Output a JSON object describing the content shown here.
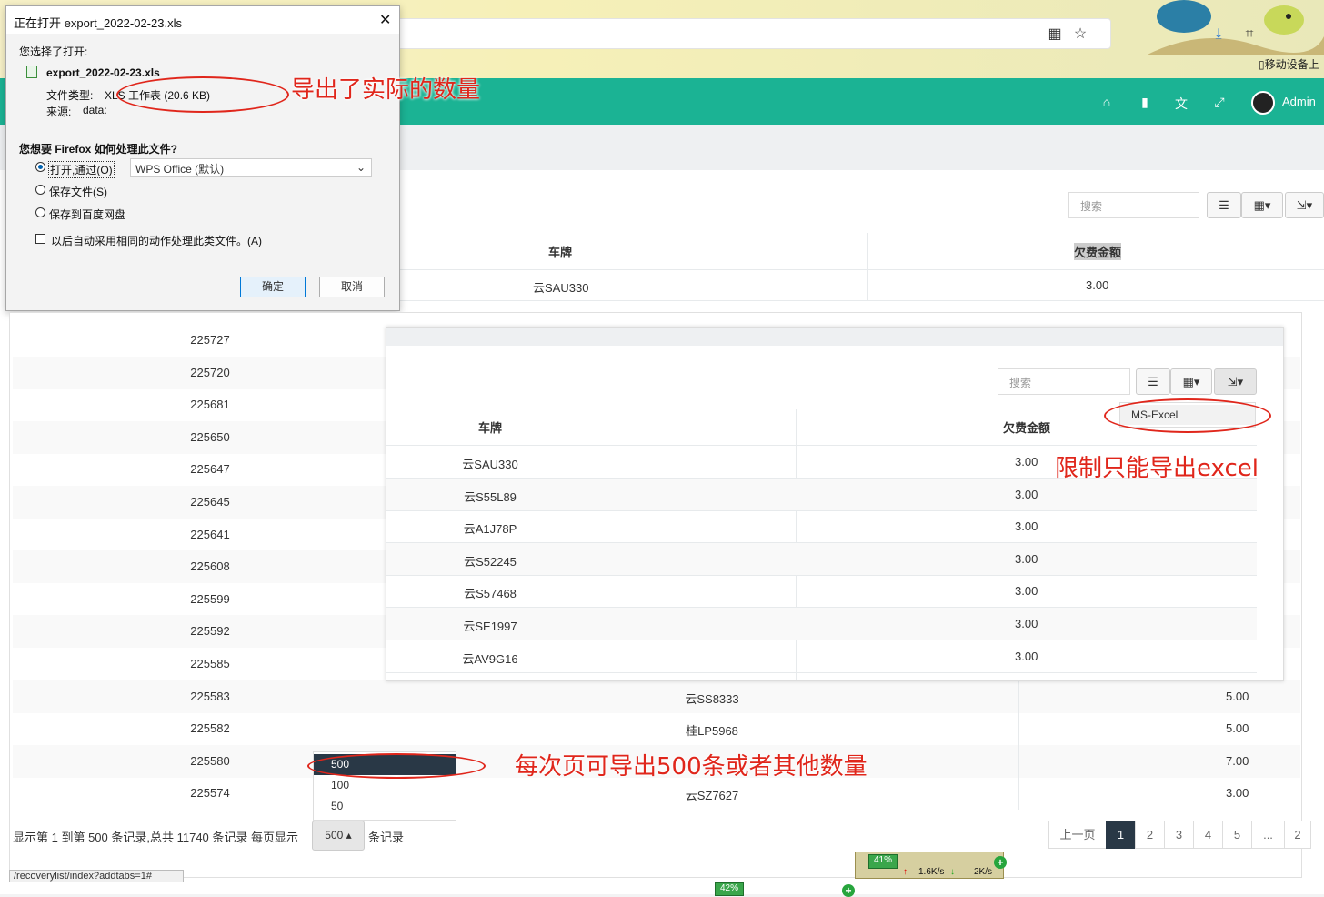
{
  "browser": {
    "mobile_device_label": "移动设备上",
    "qr_icon": "qr-code-icon",
    "bookmark_icon": "star-icon"
  },
  "header": {
    "user_name": "Admin",
    "accent_color": "#1bb394"
  },
  "back_table": {
    "search_placeholder": "搜索",
    "col_plate": "车牌",
    "col_amount": "欠费金额",
    "first_row_plate": "云SAU330",
    "first_row_amount": "3.00"
  },
  "dialog": {
    "title": "正在打开 export_2022-02-23.xls",
    "chosen_label": "您选择了打开:",
    "file_name": "export_2022-02-23.xls",
    "type_label": "文件类型:",
    "type_value": "XLS 工作表 (20.6 KB)",
    "source_label": "来源:",
    "source_value": "data:",
    "question": "您想要 Firefox 如何处理此文件?",
    "option_open": "打开,通过(O)",
    "open_app": "WPS Office (默认)",
    "option_save": "保存文件(S)",
    "option_baidu": "保存到百度网盘",
    "auto_checkbox": "以后自动采用相同的动作处理此类文件。(A)",
    "ok": "确定",
    "cancel": "取消"
  },
  "annotations": {
    "exported_count": "导出了实际的数量",
    "excel_only": "限制只能导出excel",
    "per_page": "每次页可导出500条或者其他数量"
  },
  "list": {
    "rows": [
      {
        "id": "225727"
      },
      {
        "id": "225720"
      },
      {
        "id": "225681"
      },
      {
        "id": "225650"
      },
      {
        "id": "225647"
      },
      {
        "id": "225645"
      },
      {
        "id": "225641"
      },
      {
        "id": "225608"
      },
      {
        "id": "225599"
      },
      {
        "id": "225592"
      },
      {
        "id": "225585"
      },
      {
        "id": "225583",
        "plate": "云SS8333",
        "amount": "5.00"
      },
      {
        "id": "225582",
        "plate": "桂LP5968",
        "amount": "5.00"
      },
      {
        "id": "225580",
        "plate": "",
        "amount": "7.00"
      },
      {
        "id": "225574",
        "plate": "云SZ7627",
        "amount": "3.00"
      }
    ]
  },
  "overlay": {
    "search_placeholder": "搜索",
    "export_option": "MS-Excel",
    "col_plate": "车牌",
    "col_amount": "欠费金额",
    "rows": [
      {
        "plate": "云SAU330",
        "amount": "3.00"
      },
      {
        "plate": "云S55L89",
        "amount": "3.00"
      },
      {
        "plate": "云A1J78P",
        "amount": "3.00"
      },
      {
        "plate": "云S52245",
        "amount": "3.00"
      },
      {
        "plate": "云S57468",
        "amount": "3.00"
      },
      {
        "plate": "云SE1997",
        "amount": "3.00"
      },
      {
        "plate": "云AV9G16",
        "amount": "3.00"
      }
    ]
  },
  "pagination": {
    "summary": "显示第 1 到第 500 条记录,总共 11740 条记录 每页显示",
    "page_size": "500",
    "suffix": "条记录",
    "options": [
      "500",
      "100",
      "50"
    ],
    "prev": "上一页",
    "pages": [
      "1",
      "2",
      "3",
      "4",
      "5",
      "...",
      "2"
    ]
  },
  "status_bar": {
    "url": "/recoverylist/index?addtabs=1#",
    "percent_top": "41%",
    "percent_bottom": "42%",
    "upload": "1.6K/s",
    "download": "2K/s"
  }
}
